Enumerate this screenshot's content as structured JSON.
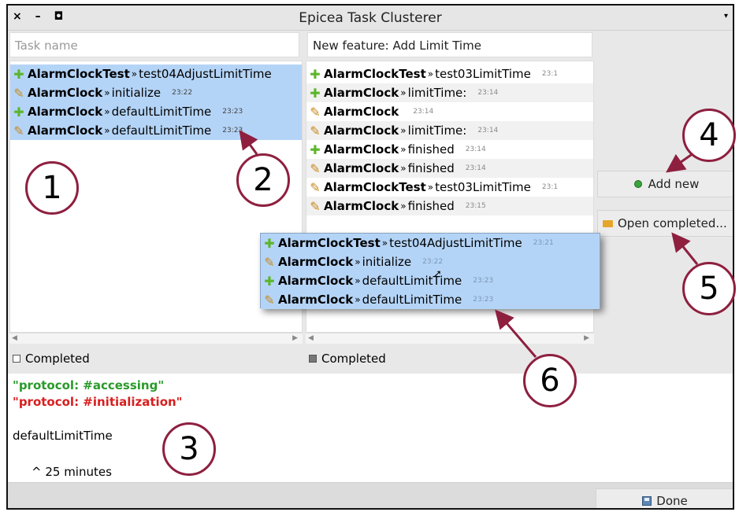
{
  "window": {
    "title": "Epicea Task Clusterer",
    "controls": "× – ◘",
    "menu_glyph": "▾"
  },
  "left_panel": {
    "task_name_placeholder": "Task name",
    "items": [
      {
        "icon": "plus",
        "cls": "AlarmClockTest",
        "sep": "»",
        "method": "test04AdjustLimitTime",
        "time": ""
      },
      {
        "icon": "pencil",
        "cls": "AlarmClock",
        "sep": "»",
        "method": "initialize",
        "time": "23:22"
      },
      {
        "icon": "plus",
        "cls": "AlarmClock",
        "sep": "»",
        "method": "defaultLimitTime",
        "time": "23:23"
      },
      {
        "icon": "pencil",
        "cls": "AlarmClock",
        "sep": "»",
        "method": "defaultLimitTime",
        "time": "23:23"
      }
    ],
    "completed_label": "Completed"
  },
  "middle_panel": {
    "task_name_value": "New feature: Add Limit Time",
    "items": [
      {
        "icon": "plus",
        "cls": "AlarmClockTest",
        "sep": "»",
        "method": "test03LimitTime",
        "time": "23:1"
      },
      {
        "icon": "plus",
        "cls": "AlarmClock",
        "sep": "»",
        "method": "limitTime:",
        "time": "23:14"
      },
      {
        "icon": "pencil",
        "cls": "AlarmClock",
        "sep": "",
        "method": "",
        "time": "23:14"
      },
      {
        "icon": "pencil",
        "cls": "AlarmClock",
        "sep": "»",
        "method": "limitTime:",
        "time": "23:14"
      },
      {
        "icon": "plus",
        "cls": "AlarmClock",
        "sep": "»",
        "method": "finished",
        "time": "23:14"
      },
      {
        "icon": "pencil",
        "cls": "AlarmClock",
        "sep": "»",
        "method": "finished",
        "time": "23:14"
      },
      {
        "icon": "pencil",
        "cls": "AlarmClockTest",
        "sep": "»",
        "method": "test03LimitTime",
        "time": "23:1"
      },
      {
        "icon": "pencil",
        "cls": "AlarmClock",
        "sep": "»",
        "method": "finished",
        "time": "23:15"
      }
    ],
    "completed_label": "Completed"
  },
  "drag_popup": {
    "items": [
      {
        "icon": "plus",
        "cls": "AlarmClockTest",
        "sep": "»",
        "method": "test04AdjustLimitTime",
        "time": "23:21"
      },
      {
        "icon": "pencil",
        "cls": "AlarmClock",
        "sep": "»",
        "method": "initialize",
        "time": "23:22"
      },
      {
        "icon": "plus",
        "cls": "AlarmClock",
        "sep": "»",
        "method": "defaultLimitTime",
        "time": "23:23"
      },
      {
        "icon": "pencil",
        "cls": "AlarmClock",
        "sep": "»",
        "method": "defaultLimitTime",
        "time": "23:23"
      }
    ]
  },
  "detail": {
    "protocol_added": "\"protocol: #accessing\"",
    "protocol_removed": "\"protocol: #initialization\"",
    "method": "defaultLimitTime",
    "duration": "^ 25 minutes"
  },
  "buttons": {
    "add_new": "Add new",
    "open_completed": "Open completed...",
    "done": "Done"
  },
  "callouts": [
    "1",
    "2",
    "3",
    "4",
    "5",
    "6"
  ],
  "colors": {
    "selection": "#b4d4f7",
    "added_icon": "#5db52b",
    "modified_icon": "#c98a1d",
    "callout_border": "#8e1f3f",
    "protocol_added": "#2a9a2a",
    "protocol_removed": "#d81e1e"
  },
  "icons": {
    "plus": "✚",
    "pencil": "✎",
    "scroll_left": "◀",
    "scroll_right": "▶",
    "cursor": "➚"
  }
}
